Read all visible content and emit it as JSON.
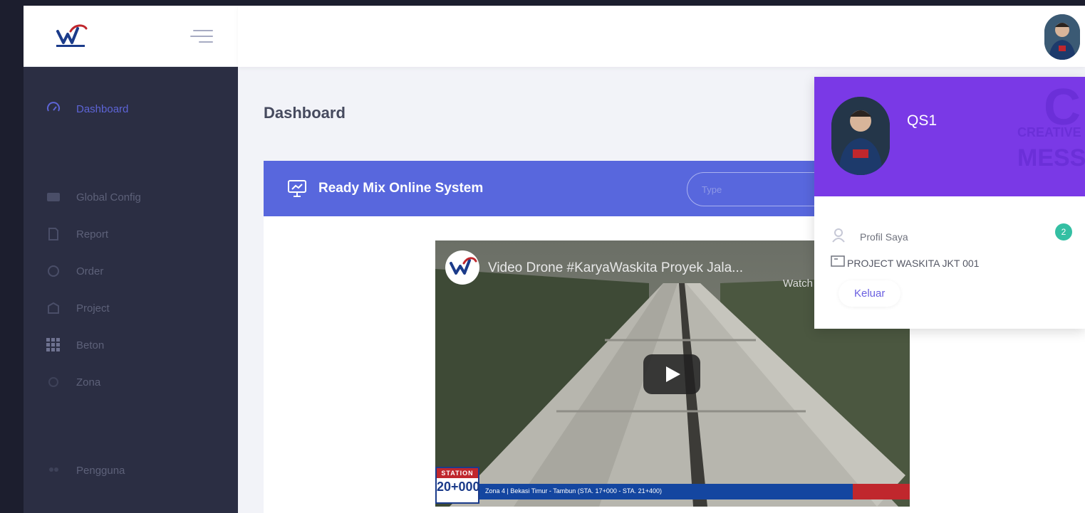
{
  "sidebar": {
    "items": [
      {
        "label": "Dashboard",
        "icon": "dashboard-icon"
      },
      {
        "label": "Global Config",
        "icon": "config-icon"
      },
      {
        "label": "Report",
        "icon": "report-icon"
      },
      {
        "label": "Order",
        "icon": "order-icon"
      },
      {
        "label": "Project",
        "icon": "project-icon"
      },
      {
        "label": "Beton",
        "icon": "grid-icon"
      },
      {
        "label": "Zona",
        "icon": "zone-icon"
      },
      {
        "label": "Pengguna",
        "icon": "users-icon"
      }
    ]
  },
  "main": {
    "page_title": "Dashboard",
    "portlet_title": "Ready Mix Online System",
    "search_placeholder": "Type"
  },
  "video": {
    "title": "Video Drone #KaryaWaskita Proyek Jala...",
    "watch_label": "Watch",
    "station_label": "STATION",
    "station_value": "20+000",
    "ticker_text": "Zona 4 | Bekasi Timur - Tambun (STA. 17+000 - STA. 21+400)"
  },
  "user_menu": {
    "name": "QS1",
    "items": [
      {
        "label": "Profil Saya",
        "icon": "profile-icon"
      },
      {
        "label": "PROJECT WASKITA JKT 001",
        "icon": "project-icon"
      }
    ],
    "badge": "2",
    "logout_label": "Keluar",
    "bg_word_1": "CREATIVE",
    "bg_word_2": "MESS",
    "bg_letter": "C"
  },
  "colors": {
    "sidebar_bg": "#2b2e43",
    "accent": "#5867dd",
    "dropdown_header": "#7a39e6",
    "badge": "#34bfa3"
  }
}
